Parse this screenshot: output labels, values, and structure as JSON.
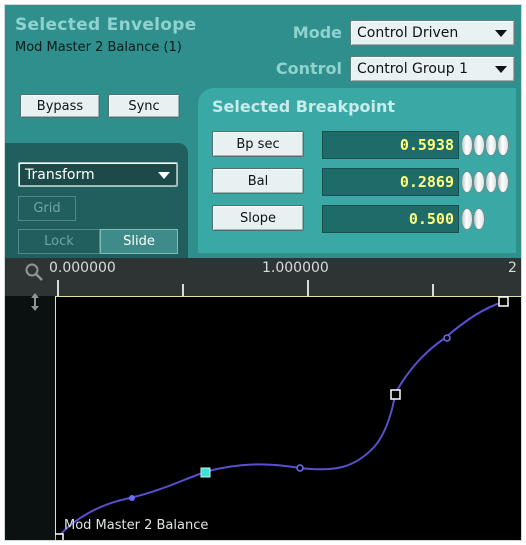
{
  "header": {
    "title": "Selected Envelope",
    "subtitle": "Mod Master 2 Balance (1)",
    "mode_label": "Mode",
    "mode_value": "Control Driven",
    "control_label": "Control",
    "control_value": "Control Group 1"
  },
  "buttons": {
    "bypass": "Bypass",
    "sync": "Sync"
  },
  "breakpoint": {
    "title": "Selected Breakpoint",
    "rows": [
      {
        "label": "Bp sec",
        "value": "0.5938"
      },
      {
        "label": "Bal",
        "value": "0.2869"
      },
      {
        "label": "Slope",
        "value": "0.500"
      }
    ]
  },
  "toolbox": {
    "transform": "Transform",
    "grid": "Grid",
    "lock": "Lock",
    "slide": "Slide"
  },
  "ruler": {
    "labels": [
      "0.000000",
      "1.000000",
      "2"
    ]
  },
  "graph": {
    "envelope_name": "Mod Master 2 Balance",
    "line_color": "#5a4fd0",
    "selected_color": "#3fe0d8"
  },
  "icons": {
    "zoom": "magnifier-icon",
    "vzoom": "vertical-arrows-icon"
  }
}
